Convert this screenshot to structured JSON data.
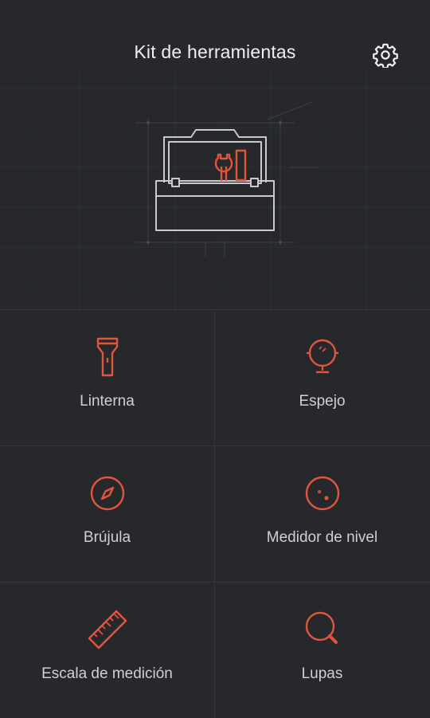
{
  "header": {
    "title": "Kit de herramientas",
    "settings_icon": "gear-icon"
  },
  "hero": {
    "illustration": "toolbox-blueprint-illustration"
  },
  "colors": {
    "accent": "#e2553d",
    "background": "#26282b",
    "line": "#34373b"
  },
  "tools": [
    {
      "label": "Linterna",
      "icon": "flashlight-icon"
    },
    {
      "label": "Espejo",
      "icon": "mirror-icon"
    },
    {
      "label": "Brújula",
      "icon": "compass-icon"
    },
    {
      "label": "Medidor de nivel",
      "icon": "level-meter-icon"
    },
    {
      "label": "Escala de medición",
      "icon": "ruler-icon"
    },
    {
      "label": "Lupas",
      "icon": "magnifier-icon"
    }
  ]
}
